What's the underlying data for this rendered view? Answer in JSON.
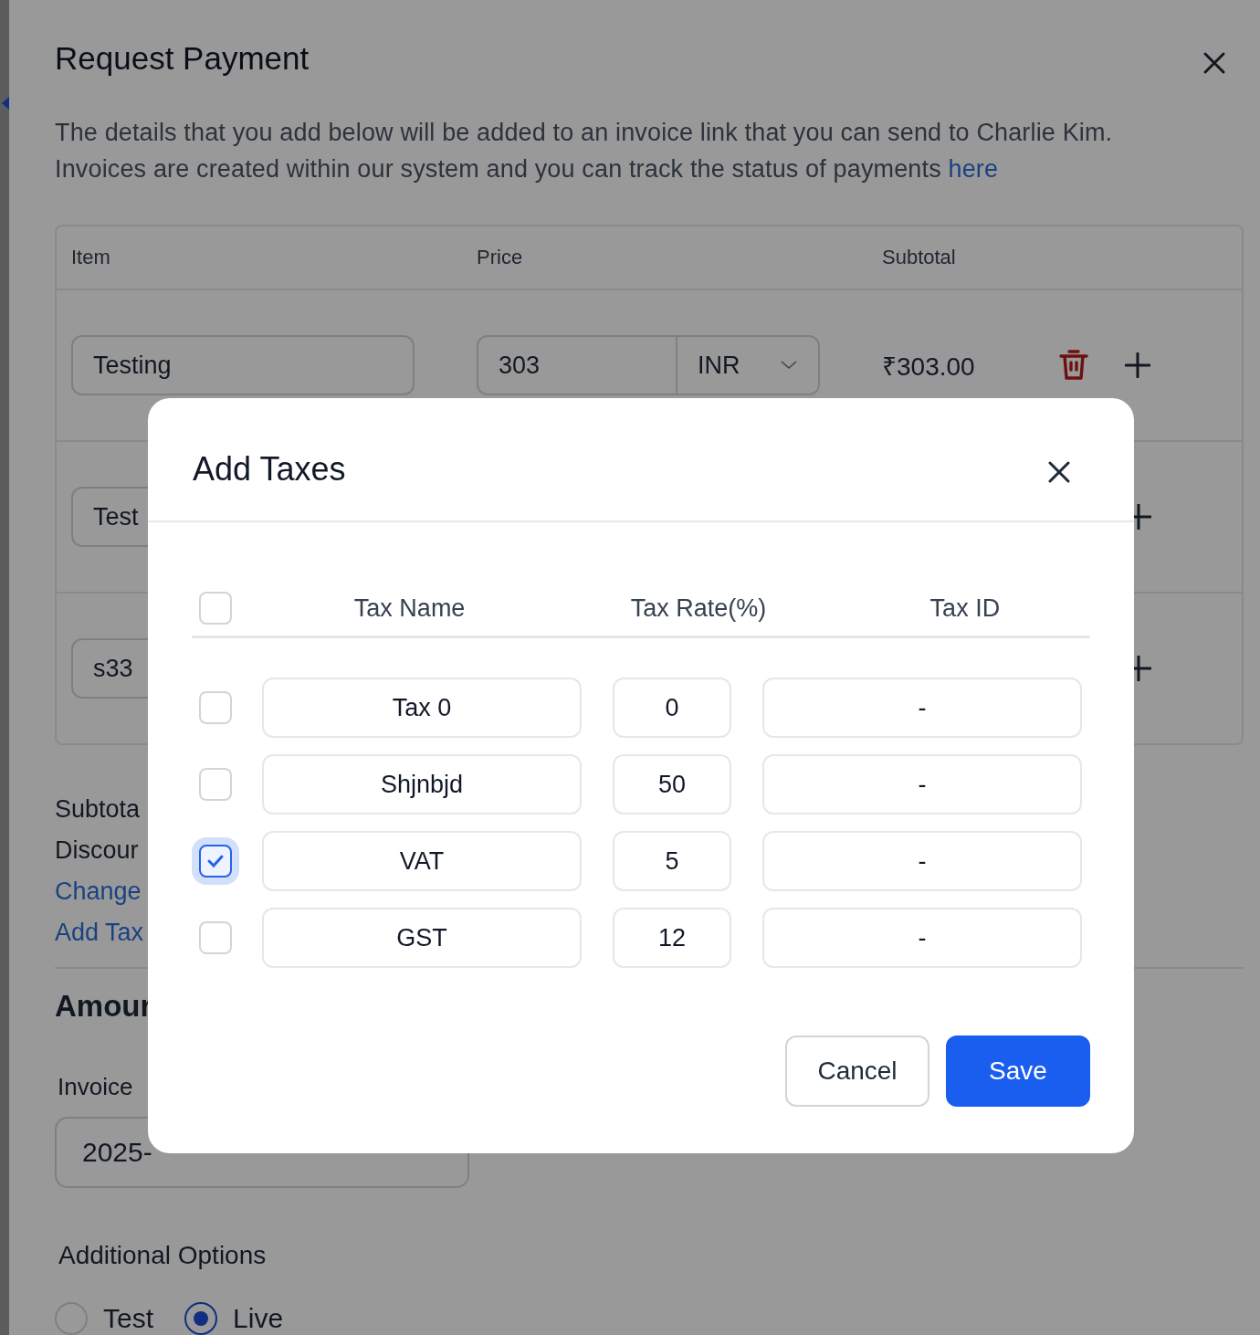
{
  "page": {
    "title": "Request Payment",
    "description_lines": [
      "The details that you add below will be added to an invoice link that you can send to Charlie Kim.",
      "Invoices are created within our system and you can track the status of payments"
    ],
    "description_link": "here"
  },
  "items_table": {
    "columns": [
      "Item",
      "Price",
      "Subtotal"
    ],
    "rows": [
      {
        "item": "Testing",
        "price": "303",
        "currency": "INR",
        "subtotal": "₹303.00"
      },
      {
        "item": "Test"
      },
      {
        "item": "s33"
      }
    ]
  },
  "summary": {
    "labels": [
      "Subtota",
      "Discour"
    ],
    "links": [
      "Change",
      "Add Tax"
    ]
  },
  "amount_heading": "Amour",
  "invoice": {
    "label": "Invoice",
    "date": "2025-"
  },
  "additional_options": {
    "title": "Additional Options",
    "choices": [
      {
        "label": "Test",
        "selected": false
      },
      {
        "label": "Live",
        "selected": true
      }
    ]
  },
  "modal": {
    "title": "Add Taxes",
    "select_all_checked": false,
    "columns": [
      "Tax Name",
      "Tax Rate(%)",
      "Tax ID"
    ],
    "rows": [
      {
        "name": "Tax 0",
        "rate": "0",
        "tax_id": "-",
        "checked": false
      },
      {
        "name": "Shjnbjd",
        "rate": "50",
        "tax_id": "-",
        "checked": false
      },
      {
        "name": "VAT",
        "rate": "5",
        "tax_id": "-",
        "checked": true
      },
      {
        "name": "GST",
        "rate": "12",
        "tax_id": "-",
        "checked": false
      }
    ],
    "buttons": [
      {
        "label": "Cancel",
        "kind": "secondary"
      },
      {
        "label": "Save",
        "kind": "primary"
      }
    ]
  }
}
